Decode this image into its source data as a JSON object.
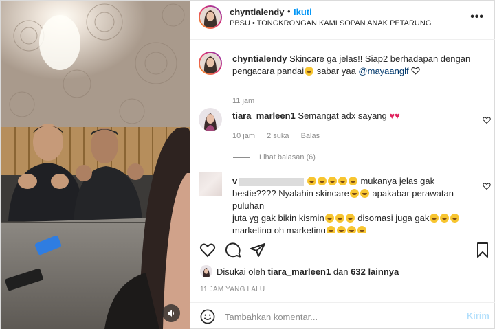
{
  "post": {
    "author": "chyntialendy",
    "follow_label": "Ikuti",
    "separator": "•",
    "location": "PBSU • TONGKRONGAN KAMI SOPAN ANAK PETARUNG",
    "more_icon": "more-horizontal-icon"
  },
  "caption": {
    "username": "chyntialendy",
    "text_1": "Skincare ga jelas!! Siap2 berhadapan dengan pengacara pandai",
    "text_2": " sabar yaa ",
    "mention": "@mayaanglf",
    "time": "11 jam"
  },
  "comments": [
    {
      "username": "tiara_marleen1",
      "text": "Semangat adx sayang",
      "time": "10 jam",
      "likes": "2 suka",
      "reply_label": "Balas",
      "view_replies": "Lihat balasan (6)"
    },
    {
      "username_visible": "v",
      "line_1": " mukanya jelas gak",
      "line_2a": "bestie???? Nyalahin skincare",
      "line_2b": " apakabar perawatan puluhan",
      "line_3a": "juta yg gak bikin kismin",
      "line_3b": " disomasi juga gak",
      "line_4": "marketing oh marketing"
    }
  ],
  "engagement": {
    "liked_prefix": "Disukai oleh ",
    "liked_user": "tiara_marleen1",
    "liked_mid": " dan ",
    "liked_count": "632 lainnya",
    "timestamp": "11 JAM YANG LALU"
  },
  "composer": {
    "placeholder": "Tambahkan komentar...",
    "post_label": "Kirim"
  },
  "colors": {
    "accent": "#0095f6",
    "post_disabled": "#b2dffc",
    "heart": "#e0245e",
    "muted": "#8e8e8e"
  }
}
